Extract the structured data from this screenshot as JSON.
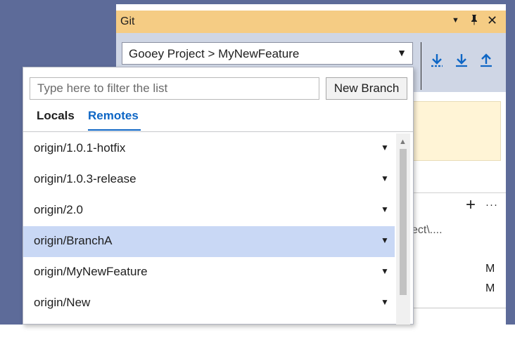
{
  "git_window": {
    "title": "Git",
    "titlebar_icons": {
      "dropdown": "triangle-down-icon",
      "pin": "pin-icon",
      "close": "close-icon"
    },
    "branch_selector": "Gooey Project > MyNewFeature",
    "sync_icons": [
      "fetch-icon",
      "pull-icon",
      "push-icon"
    ],
    "changes": {
      "path_fragment": "ect\\....",
      "status_1": "M",
      "status_2": "M"
    }
  },
  "dropdown": {
    "filter_placeholder": "Type here to filter the list",
    "new_branch_label": "New Branch",
    "tabs": {
      "locals": "Locals",
      "remotes": "Remotes",
      "active": "Remotes"
    },
    "items": [
      {
        "label": "origin/1.0.1-hotfix"
      },
      {
        "label": "origin/1.0.3-release"
      },
      {
        "label": "origin/2.0"
      },
      {
        "label": "origin/BranchA",
        "selected": true
      },
      {
        "label": "origin/MyNewFeature"
      },
      {
        "label": "origin/New"
      }
    ]
  },
  "colors": {
    "background": "#5d6b99",
    "titlebar": "#f5cc84",
    "accent": "#0e66c5",
    "selection": "#c9d8f5"
  }
}
